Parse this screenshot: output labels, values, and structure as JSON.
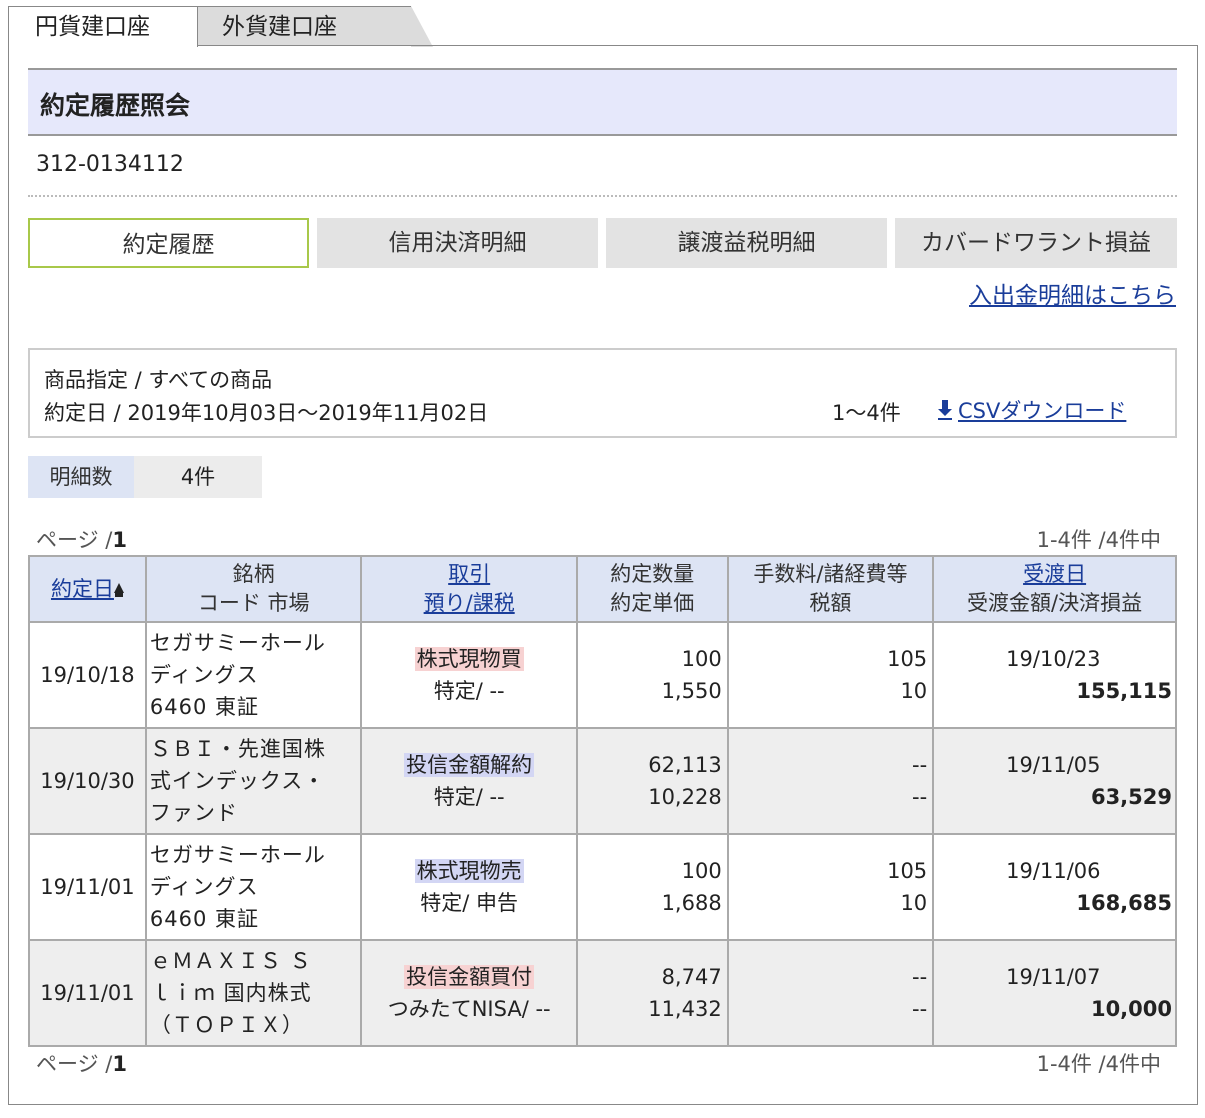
{
  "tabs": {
    "yen": "円貨建口座",
    "foreign": "外貨建口座"
  },
  "page_title": "約定履歴照会",
  "account_number": "312-0134112",
  "subtabs": [
    "約定履歴",
    "信用決済明細",
    "譲渡益税明細",
    "カバードワラント損益"
  ],
  "deposit_link": "入出金明細はこちら",
  "filter": {
    "product": "商品指定 / すべての商品",
    "date_range": "約定日 / 2019年10月03日〜2019年11月02日",
    "count": "1〜4件",
    "csv": "CSVダウンロード"
  },
  "detail_count": {
    "label": "明細数",
    "value": "4件"
  },
  "pager": {
    "page_label": "ページ /",
    "page_num": "1",
    "range": "1-4件 /4件中"
  },
  "table": {
    "headers": {
      "date": "約定日",
      "name_1": "銘柄",
      "name_2": "コード  市場",
      "trade_1": "取引",
      "trade_2": "預り/課税",
      "qty_1": "約定数量",
      "qty_2": "約定単価",
      "fee_1": "手数料/諸経費等",
      "fee_2": "税額",
      "settle_1": "受渡日",
      "settle_2": "受渡金額/決済損益"
    },
    "rows": [
      {
        "date": "19/10/18",
        "name_1": "セガサミーホール",
        "name_2": "ディングス",
        "name_3": "6460  東証",
        "trade": "株式現物買",
        "tax": "特定/ --",
        "qty": "100",
        "price": "1,550",
        "fee": "105",
        "tax_amt": "10",
        "settle_date": "19/10/23",
        "amount": "155,115",
        "type": "buy"
      },
      {
        "date": "19/10/30",
        "name_1": "ＳＢＩ・先進国株",
        "name_2": "式インデックス・",
        "name_3": "ファンド",
        "trade": "投信金額解約",
        "tax": "特定/ --",
        "qty": "62,113",
        "price": "10,228",
        "fee": "--",
        "tax_amt": "--",
        "settle_date": "19/11/05",
        "amount": "63,529",
        "type": "sell"
      },
      {
        "date": "19/11/01",
        "name_1": "セガサミーホール",
        "name_2": "ディングス",
        "name_3": "6460  東証",
        "trade": "株式現物売",
        "tax": "特定/ 申告",
        "qty": "100",
        "price": "1,688",
        "fee": "105",
        "tax_amt": "10",
        "settle_date": "19/11/06",
        "amount": "168,685",
        "type": "sell"
      },
      {
        "date": "19/11/01",
        "name_1": "ｅＭＡＸＩＳ  Ｓ",
        "name_2": "ｌｉｍ  国内株式",
        "name_3": "（ＴＯＰＩＸ）",
        "trade": "投信金額買付",
        "tax": "つみたてNISA/ --",
        "qty": "8,747",
        "price": "11,432",
        "fee": "--",
        "tax_amt": "--",
        "settle_date": "19/11/07",
        "amount": "10,000",
        "type": "buy"
      }
    ]
  },
  "colors": {
    "accent": "#1a3d9a",
    "buy_highlight": "#f7d2d2",
    "sell_highlight": "#d3d6f4",
    "header_bg": "#dde4f4"
  }
}
